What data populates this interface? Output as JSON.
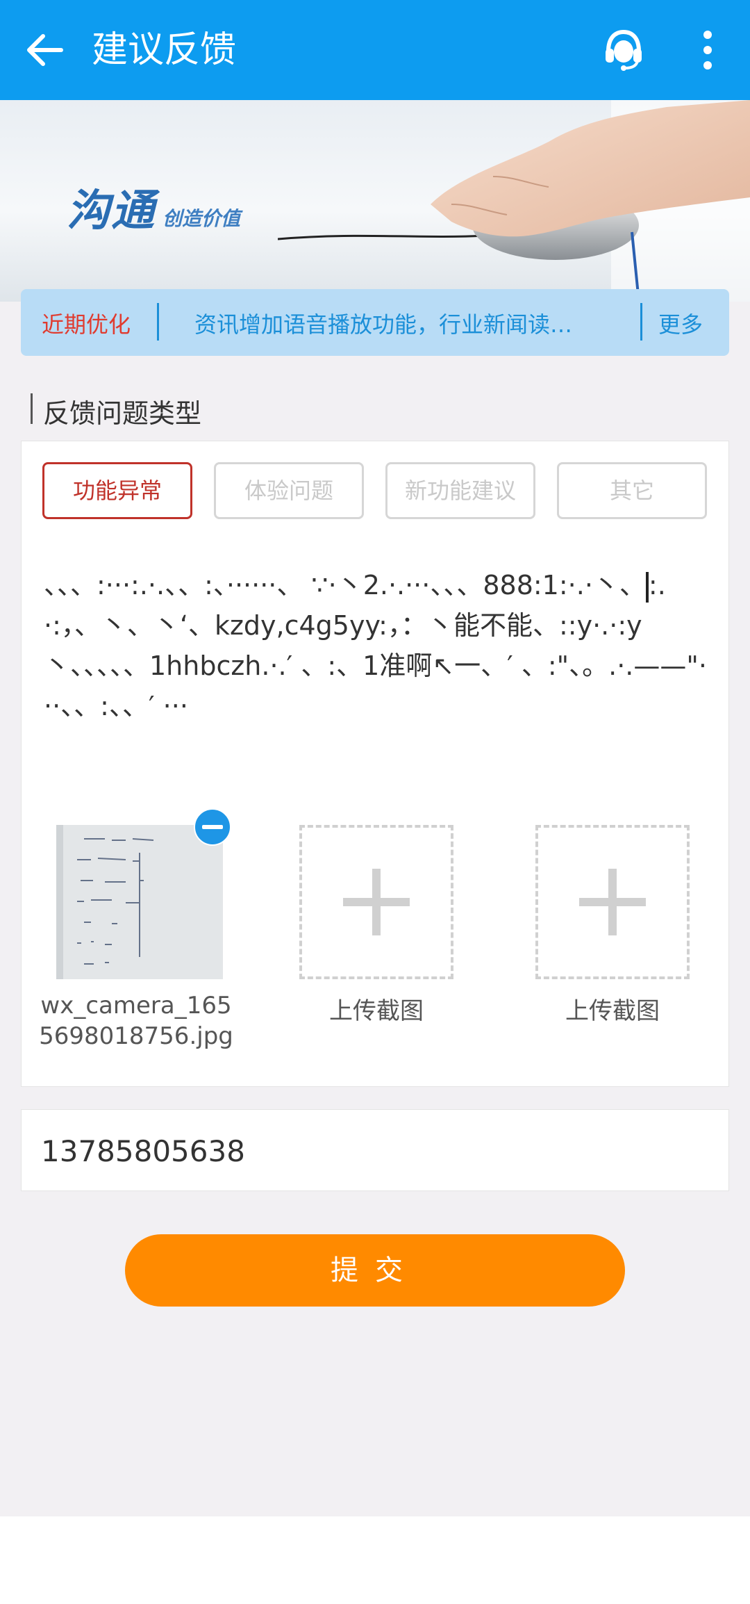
{
  "header": {
    "title": "建议反馈",
    "back_icon": "arrow-left-icon",
    "service_icon": "customer-service-icon",
    "more_icon": "more-vertical-icon"
  },
  "banner": {
    "logo_main": "沟通",
    "logo_sub": "创造价值"
  },
  "notice": {
    "label": "近期优化",
    "text": "资讯增加语音播放功能，行业新闻读…",
    "more": "更多"
  },
  "section": {
    "title": "反馈问题类型"
  },
  "feedback_types": [
    {
      "label": "功能异常",
      "selected": true
    },
    {
      "label": "体验问题",
      "selected": false
    },
    {
      "label": "新功能建议",
      "selected": false
    },
    {
      "label": "其它",
      "selected": false
    }
  ],
  "feedback": {
    "text_before_cursor": "、、、:···:.·.、、:、······、 ∵·丶2.·.···、、、888:1:·.·丶、",
    "text_after_cursor": ":.·:，、丶、丶‘、kzdy,c4g5yy:，：丶能不能、::y·.·:y丶、、、、、1hhbczh.·.′ 、:、1准啊↖一、′ 、:\"、。.·.——\"···、、:、、′ ···"
  },
  "attachments": {
    "uploaded_filename": "wx_camera_1655698018756.jpg",
    "upload_label_1": "上传截图",
    "upload_label_2": "上传截图"
  },
  "contact": {
    "phone": "13785805638"
  },
  "submit": {
    "label": "提交"
  },
  "colors": {
    "header_bg": "#0d9cf0",
    "accent_red": "#c0322a",
    "submit_orange": "#ff8a00",
    "notice_bg": "#b8dcf6",
    "notice_text": "#1b8fd8"
  }
}
